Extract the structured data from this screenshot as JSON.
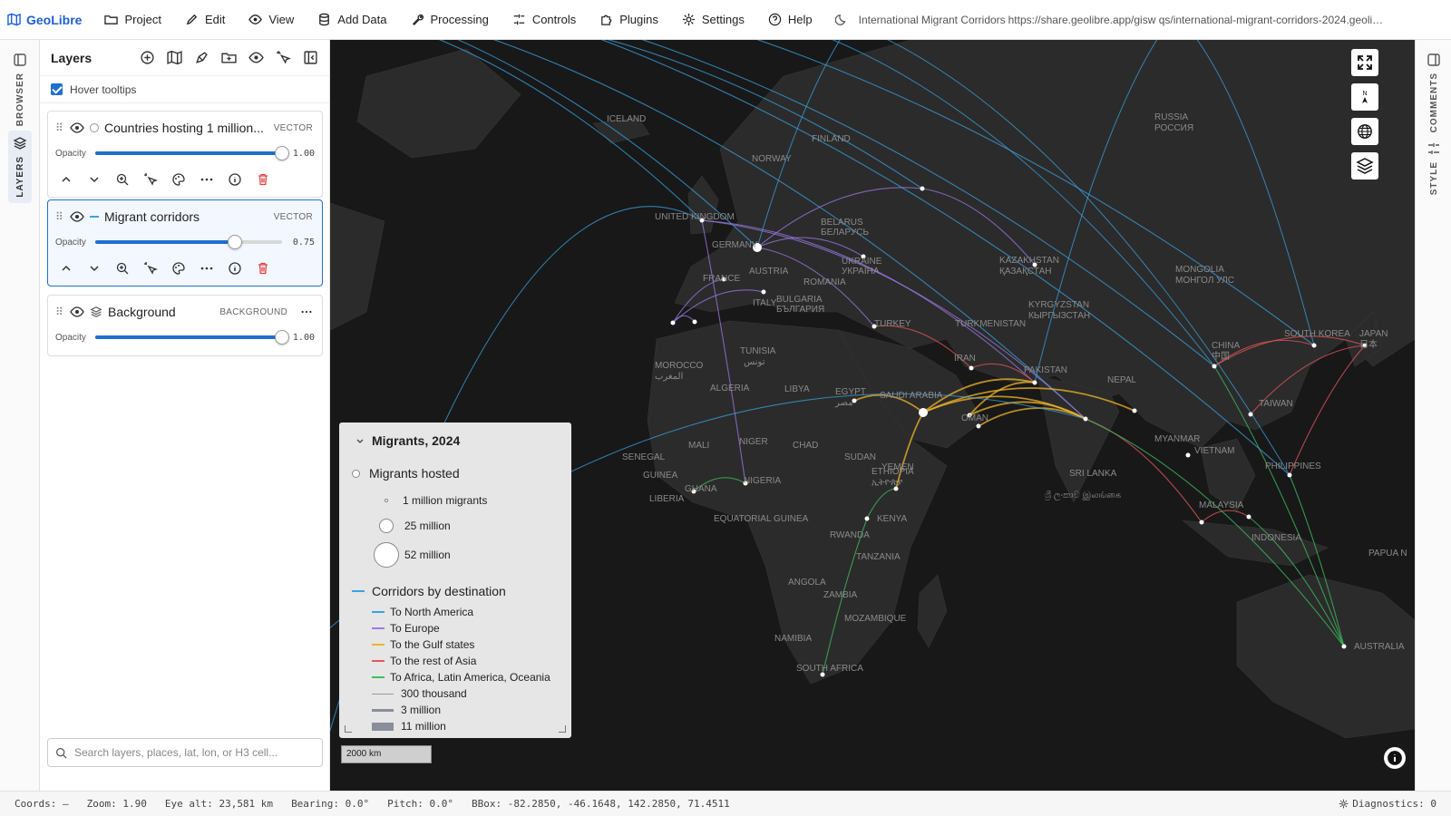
{
  "app": {
    "name": "GeoLibre"
  },
  "menu": [
    {
      "label": "Project",
      "icon": "folder-icon"
    },
    {
      "label": "Edit",
      "icon": "pencil-icon"
    },
    {
      "label": "View",
      "icon": "eye-icon"
    },
    {
      "label": "Add Data",
      "icon": "database-icon"
    },
    {
      "label": "Processing",
      "icon": "wrench-icon"
    },
    {
      "label": "Controls",
      "icon": "sliders-icon"
    },
    {
      "label": "Plugins",
      "icon": "puzzle-icon"
    },
    {
      "label": "Settings",
      "icon": "gear-icon"
    },
    {
      "label": "Help",
      "icon": "help-icon"
    }
  ],
  "project_title": "International Migrant Corridors",
  "share_url": "https://share.geolibre.app/gisw qs/international-migrant-corridors-2024.geolibr...",
  "left_rail": {
    "browser_label": "BROWSER",
    "layers_label": "LAYERS"
  },
  "right_rail": {
    "comments_label": "COMMENTS",
    "style_label": "STYLE"
  },
  "layers_panel": {
    "title": "Layers",
    "hover_tooltips_label": "Hover tooltips",
    "hover_tooltips_checked": true,
    "opacity_label": "Opacity",
    "search_placeholder": "Search layers, places, lat, lon, or H3 cell...",
    "layers": [
      {
        "name": "Countries hosting 1 million...",
        "type": "VECTOR",
        "opacity": "1.00",
        "opacity_value": 1.0,
        "visible": true,
        "selected": false
      },
      {
        "name": "Migrant corridors",
        "type": "VECTOR",
        "opacity": "0.75",
        "opacity_value": 0.75,
        "visible": true,
        "selected": true
      },
      {
        "name": "Background",
        "type": "BACKGROUND",
        "opacity": "1.00",
        "opacity_value": 1.0,
        "visible": true,
        "selected": false
      }
    ]
  },
  "legend": {
    "title": "Migrants, 2024",
    "hosted_heading": "Migrants hosted",
    "hosted_sizes": [
      "1 million migrants",
      "25 million",
      "52 million"
    ],
    "corridors_heading": "Corridors by destination",
    "destinations": [
      {
        "label": "To North America",
        "color": "#3aa3e3"
      },
      {
        "label": "To Europe",
        "color": "#9b7be6"
      },
      {
        "label": "To the Gulf states",
        "color": "#f0b429"
      },
      {
        "label": "To the rest of Asia",
        "color": "#e5575b"
      },
      {
        "label": "To Africa, Latin America, Oceania",
        "color": "#3fbf5f"
      }
    ],
    "width_classes": [
      "300 thousand",
      "3 million",
      "11 million"
    ]
  },
  "map_labels": [
    "ICELAND",
    "FINLAND",
    "NORWAY",
    "RUSSIA",
    "РОССИЯ",
    "UNITED KINGDOM",
    "BELARUS",
    "БЕЛАРУСЬ",
    "GERMANY",
    "UKRAINE",
    "УКРАЇНА",
    "KAZAKHSTAN",
    "ҚАЗАҚСТАН",
    "MONGOLIA",
    "МОНГОЛ УЛС",
    "FRANCE",
    "AUSTRIA",
    "ROMANIA",
    "BULGARIA",
    "БЪЛГАРИЯ",
    "ITALY",
    "KYRGYZSTAN",
    "КЫРГЫЗСТАН",
    "TURKEY",
    "TURKMENISTAN",
    "SOUTH KOREA",
    "JAPAN",
    "日本",
    "CHINA",
    "中国",
    "TUNISIA",
    "تونس",
    "IRAN",
    "PAKISTAN",
    "MOROCCO",
    "المغرب",
    "ALGERIA",
    "LIBYA",
    "EGYPT",
    "مصر",
    "SAUDI ARABIA",
    "NEPAL",
    "TAIWAN",
    "OMAN",
    "MYANMAR",
    "VIETNAM",
    "PHILIPPINES",
    "MALI",
    "NIGER",
    "CHAD",
    "SUDAN",
    "YEMEN",
    "SENEGAL",
    "GUINEA",
    "GHANA",
    "NIGERIA",
    "ETHIOPIA",
    "ኢትዮጵያ",
    "SRI LANKA",
    "ශ්‍රී ලංකාව இலங்கை",
    "LIBERIA",
    "EQUATORIAL GUINEA",
    "KENYA",
    "MALAYSIA",
    "INDONESIA",
    "PAPUA N",
    "RWANDA",
    "TANZANIA",
    "ANGOLA",
    "ZAMBIA",
    "MOZAMBIQUE",
    "NAMIBIA",
    "SOUTH AFRICA",
    "AUSTRALIA"
  ],
  "scale_bar": "2000 km",
  "status": {
    "coords": "Coords: —",
    "zoom": "Zoom: 1.90",
    "eye_alt": "Eye alt: 23,581 km",
    "bearing": "Bearing: 0.0°",
    "pitch": "Pitch: 0.0°",
    "bbox": "BBox: -82.2850, -46.1648, 142.2850, 71.4511",
    "diagnostics": "Diagnostics: 0"
  }
}
